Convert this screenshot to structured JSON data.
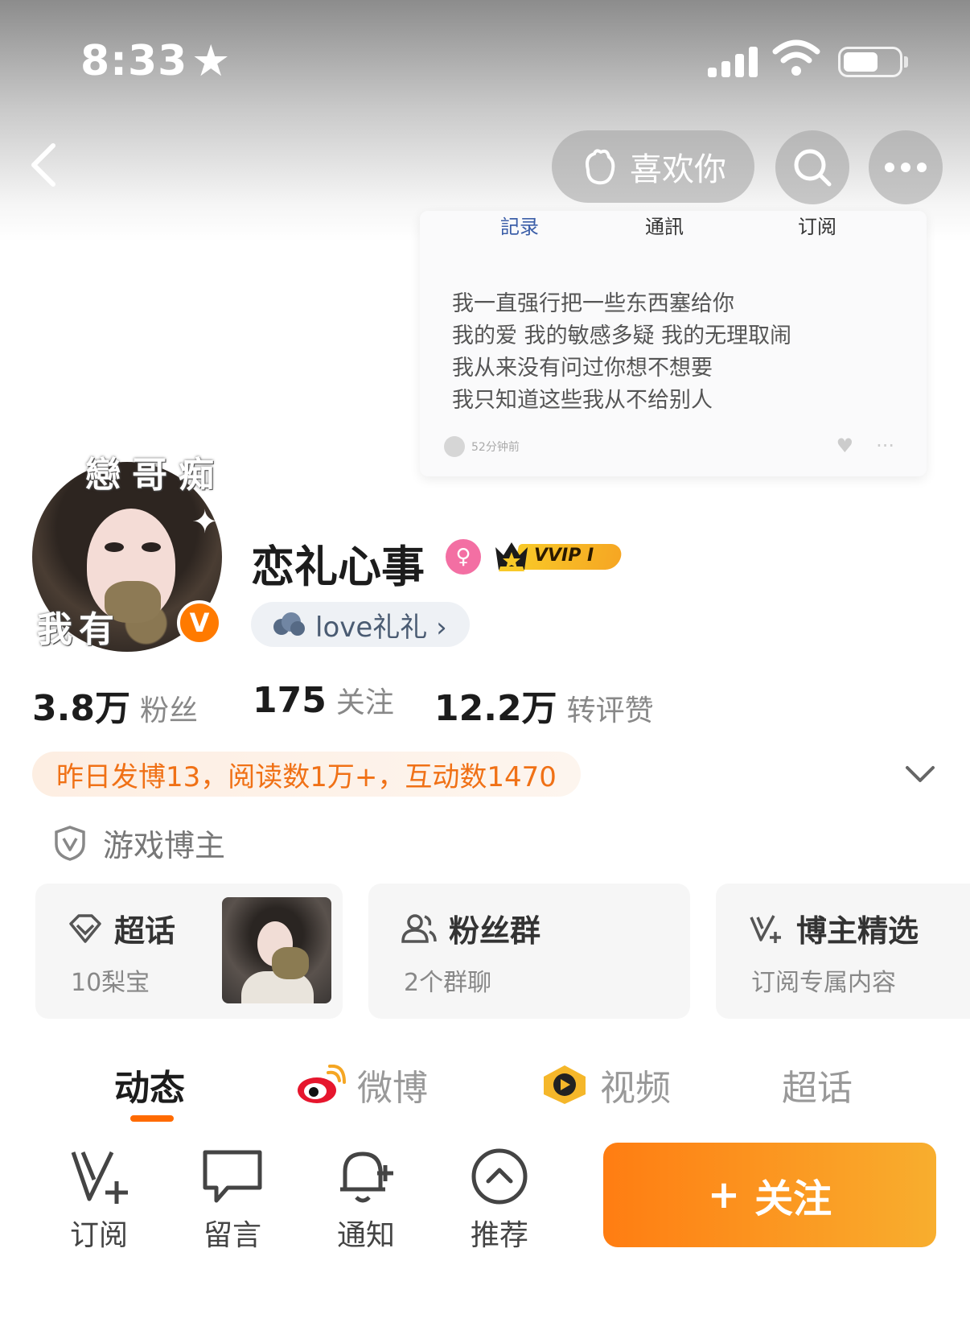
{
  "status_bar": {
    "time": "8:33"
  },
  "nav": {
    "like_label": "喜欢你"
  },
  "note_card": {
    "tabs": [
      "記录",
      "通訊",
      "订阅"
    ],
    "lines": [
      "我一直强行把一些东西塞给你",
      "我的爱  我的敏感多疑  我的无理取闹",
      "我从来没有问过你想不想要",
      "我只知道这些我从不给别人"
    ],
    "meta": "52分钟前"
  },
  "avatar": {
    "overlay_top": "戀哥痴",
    "overlay_bottom": "我有"
  },
  "profile": {
    "name": "恋礼心事",
    "vip_label": "VVIP I",
    "group_tag": "love礼礼 ›"
  },
  "stats": [
    {
      "num": "3.8万",
      "label": "粉丝"
    },
    {
      "num": "175",
      "label": "关注"
    },
    {
      "num": "12.2万",
      "label": "转评赞"
    }
  ],
  "highlight": "昨日发博13，阅读数1万+，互动数1470",
  "category_tag": "游戏博主",
  "cards": [
    {
      "title": "超话",
      "sub": "10梨宝"
    },
    {
      "title": "粉丝群",
      "sub": "2个群聊"
    },
    {
      "title": "博主精选",
      "sub": "订阅专属内容"
    }
  ],
  "tabs": [
    "动态",
    "微博",
    "视频",
    "超话"
  ],
  "actions": [
    "订阅",
    "留言",
    "通知",
    "推荐"
  ],
  "follow_label": "关注",
  "colors": {
    "accent": "#ff6a00",
    "highlight_text": "#f07116",
    "follow_start": "#ff7d12",
    "follow_end": "#f8ae2e"
  }
}
